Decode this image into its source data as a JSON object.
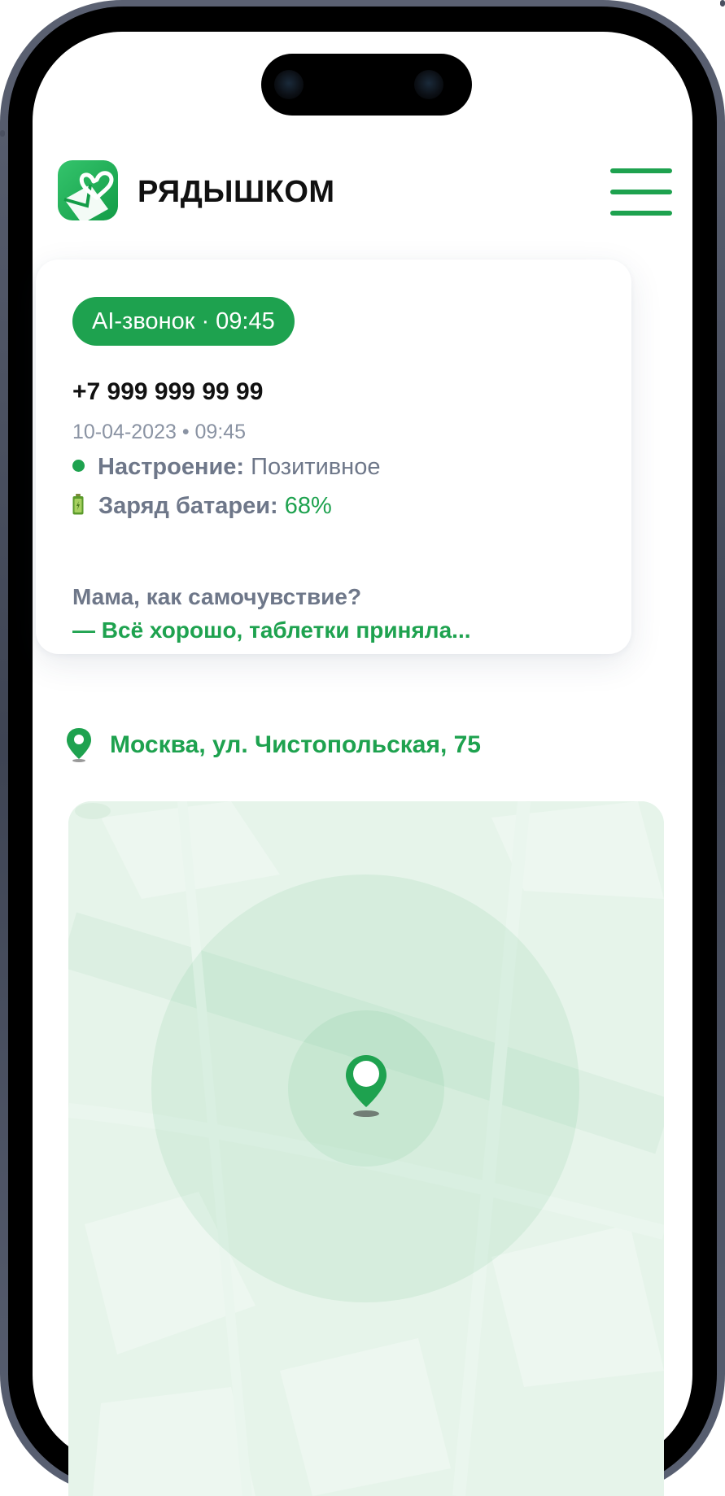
{
  "brand": {
    "name": "РЯДЫШКОМ"
  },
  "call_card": {
    "badge": "AI-звонок · 09:45",
    "phone": "+7 999 999 99 99",
    "datetime": "10-04-2023 • 09:45",
    "mood_label": "Настроение:",
    "mood_value": "Позитивное",
    "battery_label": "Заряд батареи:",
    "battery_value": "68%",
    "question": "Мама, как самочувствие?",
    "answer": "— Всё хорошо, таблетки приняла..."
  },
  "location": {
    "address": "Москва, ул. Чистопольская, 75"
  },
  "colors": {
    "accent": "#1ea24f",
    "muted": "#6e7789",
    "map_bg": "#e6f4ea"
  },
  "icons": {
    "logo": "heart-envelope-icon",
    "menu": "hamburger-menu-icon",
    "mood": "status-dot-icon",
    "battery": "battery-icon",
    "location": "map-pin-icon"
  }
}
